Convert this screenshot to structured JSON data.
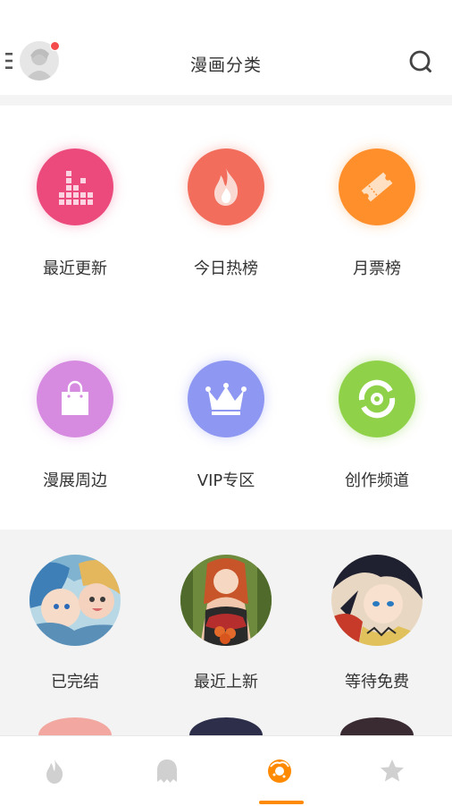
{
  "header": {
    "title": "漫画分类",
    "menu_icon": "menu-icon",
    "search_icon": "search-icon",
    "notification_color": "#f44c4c"
  },
  "categories": [
    {
      "label": "最近更新",
      "icon": "blocks-update-icon",
      "color": "#ec4a7d"
    },
    {
      "label": "今日热榜",
      "icon": "flame-icon",
      "color": "#f26d5c"
    },
    {
      "label": "月票榜",
      "icon": "ticket-icon",
      "color": "#ff8f2b"
    },
    {
      "label": "漫展周边",
      "icon": "shopping-bag-icon",
      "color": "#d78be0"
    },
    {
      "label": "VIP专区",
      "icon": "crown-icon",
      "color": "#8e97f2"
    },
    {
      "label": "创作频道",
      "icon": "creation-icon",
      "color": "#8fd24a"
    }
  ],
  "recommendations": [
    {
      "label": "已完结"
    },
    {
      "label": "最近上新"
    },
    {
      "label": "等待免费"
    }
  ],
  "tabbar": {
    "tabs": [
      {
        "icon": "flame-tab-icon"
      },
      {
        "icon": "ghost-tab-icon"
      },
      {
        "icon": "donut-tab-icon",
        "active": true
      },
      {
        "icon": "star-tab-icon"
      }
    ],
    "active_color": "#ff8a00",
    "inactive_color": "#d0d0d0"
  }
}
